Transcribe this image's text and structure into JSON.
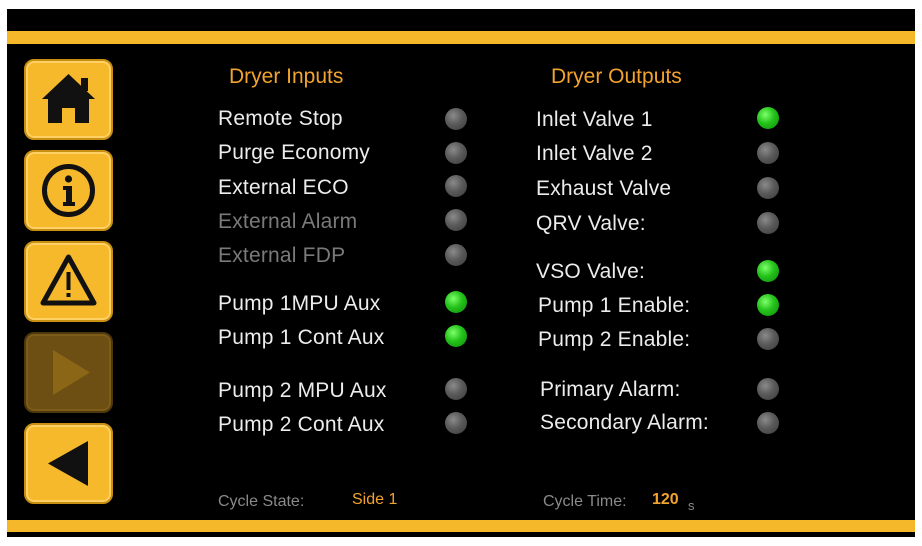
{
  "nav": {
    "buttons": [
      {
        "id": "home",
        "icon": "home-icon",
        "enabled": true
      },
      {
        "id": "info",
        "icon": "info-icon",
        "enabled": true
      },
      {
        "id": "alarm",
        "icon": "warning-icon",
        "enabled": true
      },
      {
        "id": "forward",
        "icon": "play-right-icon",
        "enabled": false
      },
      {
        "id": "back",
        "icon": "play-left-icon",
        "enabled": true
      }
    ]
  },
  "inputs": {
    "title": "Dryer Inputs",
    "items": [
      {
        "label": "Remote Stop",
        "on": false,
        "dim": false
      },
      {
        "label": "Purge Economy",
        "on": false,
        "dim": false
      },
      {
        "label": "External ECO",
        "on": false,
        "dim": false
      },
      {
        "label": "External Alarm",
        "on": false,
        "dim": true
      },
      {
        "label": "External FDP",
        "on": false,
        "dim": true
      },
      {
        "label": "Pump 1MPU Aux",
        "on": true,
        "dim": false
      },
      {
        "label": "Pump 1 Cont Aux",
        "on": true,
        "dim": false
      },
      {
        "label": "Pump 2 MPU Aux",
        "on": false,
        "dim": false
      },
      {
        "label": "Pump 2 Cont Aux",
        "on": false,
        "dim": false
      }
    ]
  },
  "outputs": {
    "title": "Dryer Outputs",
    "items": [
      {
        "label": "Inlet Valve 1",
        "on": true
      },
      {
        "label": "Inlet Valve 2",
        "on": false
      },
      {
        "label": "Exhaust Valve",
        "on": false
      },
      {
        "label": "QRV Valve:",
        "on": false
      },
      {
        "label": "VSO Valve:",
        "on": true
      },
      {
        "label": "Pump 1 Enable:",
        "on": true
      },
      {
        "label": "Pump 2 Enable:",
        "on": false
      },
      {
        "label": "Primary Alarm:",
        "on": false
      },
      {
        "label": "Secondary Alarm:",
        "on": false
      }
    ]
  },
  "footer": {
    "cycle_state_label": "Cycle State:",
    "cycle_state_value": "Side 1",
    "cycle_time_label": "Cycle Time:",
    "cycle_time_value": "120",
    "cycle_time_unit": "s"
  },
  "colors": {
    "accent": "#f5b82a",
    "title": "#f2a32e",
    "led_on": "#23c21a",
    "led_off": "#5a5a5a"
  }
}
